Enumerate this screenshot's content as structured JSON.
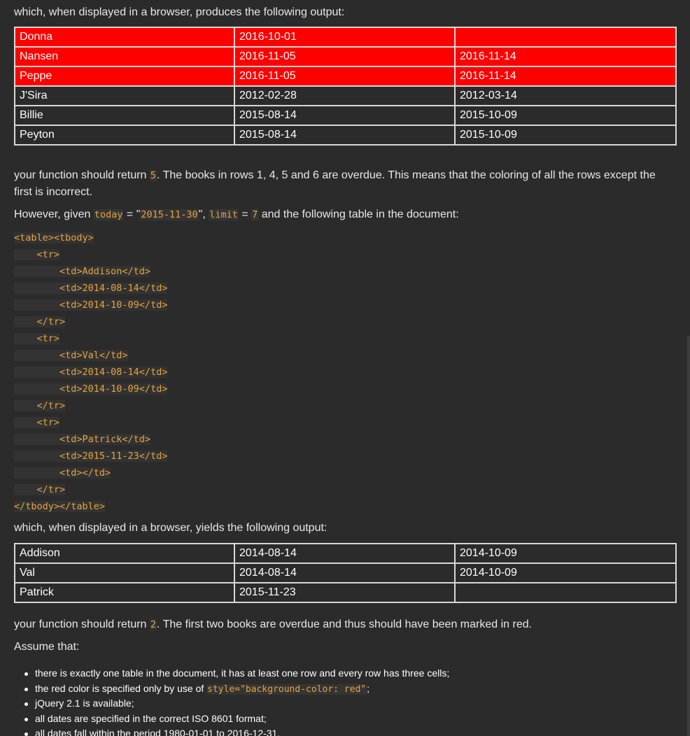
{
  "intro1": "which, when displayed in a browser, produces the following output:",
  "table1": [
    {
      "name": "Donna",
      "d1": "2016-10-01",
      "d2": "",
      "red": true
    },
    {
      "name": "Nansen",
      "d1": "2016-11-05",
      "d2": "2016-11-14",
      "red": true
    },
    {
      "name": "Peppe",
      "d1": "2016-11-05",
      "d2": "2016-11-14",
      "red": true
    },
    {
      "name": "J'Sira",
      "d1": "2012-02-28",
      "d2": "2012-03-14",
      "red": false
    },
    {
      "name": "Billie",
      "d1": "2015-08-14",
      "d2": "2015-10-09",
      "red": false
    },
    {
      "name": "Peyton",
      "d1": "2015-08-14",
      "d2": "2015-10-09",
      "red": false
    }
  ],
  "para2": {
    "pre": "your function should return ",
    "code": "5",
    "post": ". The books in rows 1, 4, 5 and 6 are overdue. This means that the coloring of all the rows except the first is incorrect."
  },
  "para3": {
    "t1": "However, given ",
    "c1": "today",
    "t2": " = \"",
    "c2": "2015-11-30",
    "t3": "\", ",
    "c3": "limit",
    "t4": " = ",
    "c4": "7",
    "t5": " and the following table in the document:"
  },
  "code_lines": [
    "<table><tbody>",
    "    <tr>",
    "        <td>Addison</td>",
    "        <td>2014-08-14</td>",
    "        <td>2014-10-09</td>",
    "    </tr>",
    "    <tr>",
    "        <td>Val</td>",
    "        <td>2014-08-14</td>",
    "        <td>2014-10-09</td>",
    "    </tr>",
    "    <tr>",
    "        <td>Patrick</td>",
    "        <td>2015-11-23</td>",
    "        <td></td>",
    "    </tr>",
    "</tbody></table>"
  ],
  "intro2": "which, when displayed in a browser, yields the following output:",
  "table2": [
    {
      "name": "Addison",
      "d1": "2014-08-14",
      "d2": "2014-10-09"
    },
    {
      "name": "Val",
      "d1": "2014-08-14",
      "d2": "2014-10-09"
    },
    {
      "name": "Patrick",
      "d1": "2015-11-23",
      "d2": ""
    }
  ],
  "para5": {
    "pre": "your function should return ",
    "code": "2",
    "post": ". The first two books are overdue and thus should have been marked in red."
  },
  "assume": "Assume that:",
  "bullets": [
    {
      "text": "there is exactly one table in the document, it has at least one row and every row has three cells;"
    },
    {
      "pre": "the red color is specified only by use of ",
      "code": "style=\"background-color: red\"",
      "post": ";"
    },
    {
      "text": "jQuery 2.1 is available;"
    },
    {
      "text": "all dates are specified in the correct ISO 8601 format;"
    },
    {
      "text": "all dates fall within the period 1980-01-01 to 2016-12-31."
    }
  ],
  "colors": {
    "background": "#2b2b2b",
    "code": "#e8a33d",
    "overdue_row": "#ff0000",
    "border": "#d8d8d8"
  }
}
